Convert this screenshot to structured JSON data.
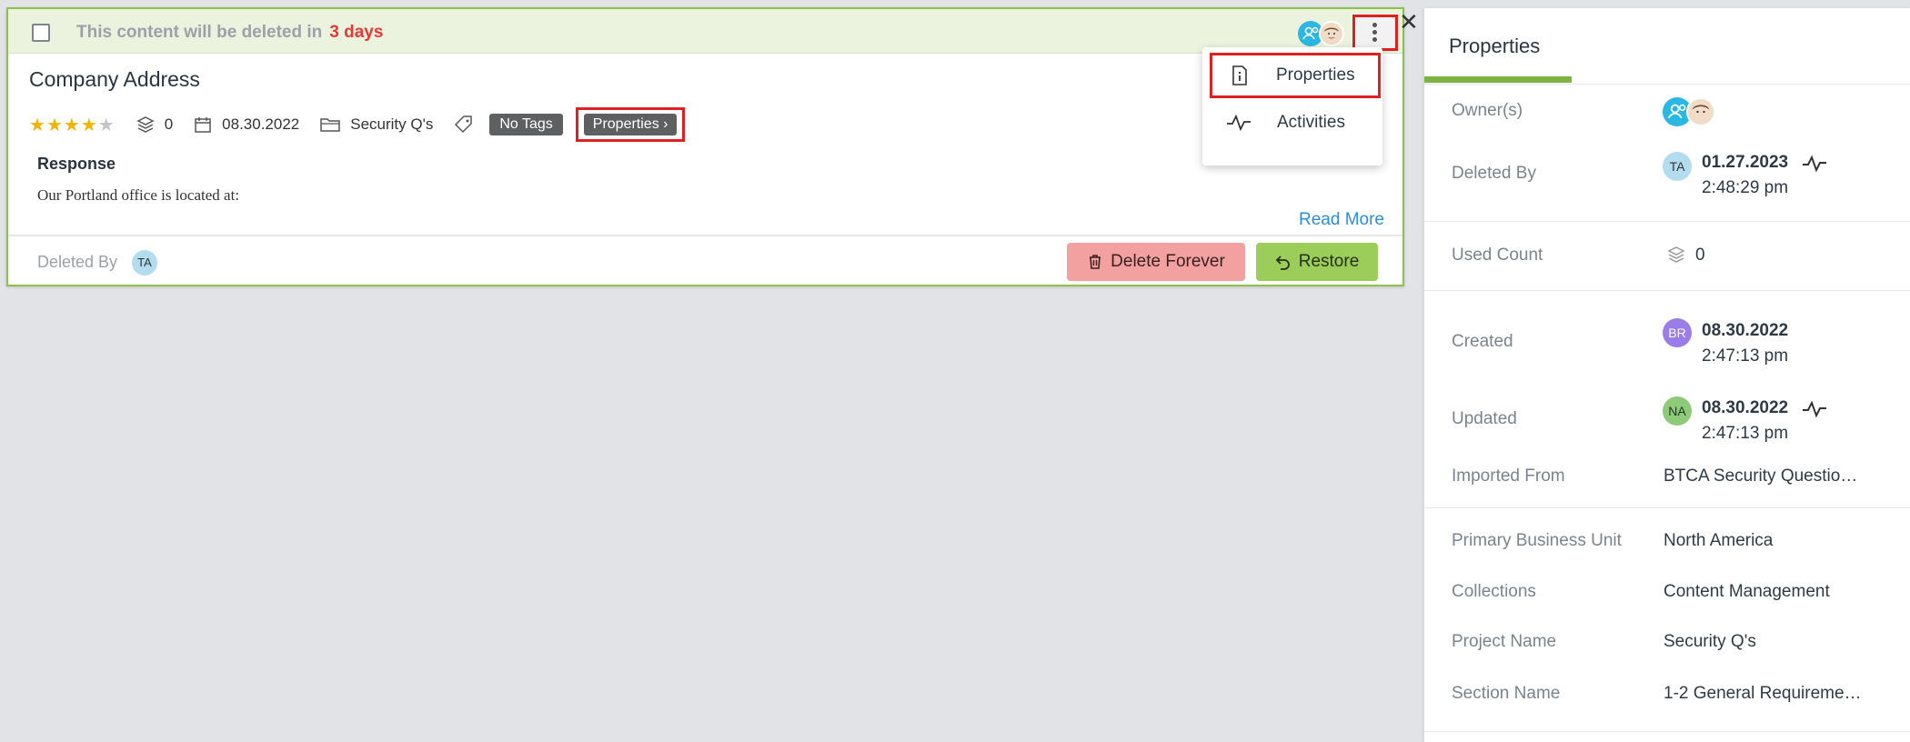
{
  "card": {
    "banner_text": "This content will be deleted in",
    "banner_days": "3 days",
    "title": "Company Address",
    "rating": 4,
    "rating_max": 5,
    "used_count": "0",
    "date": "08.30.2022",
    "project": "Security Q's",
    "tags": "No Tags",
    "properties_label": "Properties",
    "response_label": "Response",
    "response_text": "Our Portland office is located at:",
    "read_more": "Read More",
    "deleted_by_label": "Deleted By",
    "deleted_by_initials": "TA",
    "delete_forever": "Delete Forever",
    "restore": "Restore"
  },
  "menu": {
    "items": [
      {
        "label": "Properties",
        "icon": "info-doc-icon"
      },
      {
        "label": "Activities",
        "icon": "activity-pulse-icon"
      }
    ]
  },
  "panel": {
    "title": "Properties",
    "owners_label": "Owner(s)",
    "deleted_by": {
      "label": "Deleted By",
      "initials": "TA",
      "date": "01.27.2023",
      "time": "2:48:29 pm"
    },
    "used_count": {
      "label": "Used Count",
      "value": "0"
    },
    "created": {
      "label": "Created",
      "initials": "BR",
      "date": "08.30.2022",
      "time": "2:47:13 pm"
    },
    "updated": {
      "label": "Updated",
      "initials": "NA",
      "date": "08.30.2022",
      "time": "2:47:13 pm"
    },
    "imported_from": {
      "label": "Imported From",
      "value": "BTCA Security Questio…"
    },
    "primary_bu": {
      "label": "Primary Business Unit",
      "value": "North America"
    },
    "collections": {
      "label": "Collections",
      "value": "Content Management"
    },
    "project_name": {
      "label": "Project Name",
      "value": "Security Q's"
    },
    "section_name": {
      "label": "Section Name",
      "value": "1-2 General Requireme…"
    }
  },
  "colors": {
    "accent_green": "#8bc34a",
    "danger_red": "#e53935",
    "link_blue": "#2a8fd9"
  }
}
